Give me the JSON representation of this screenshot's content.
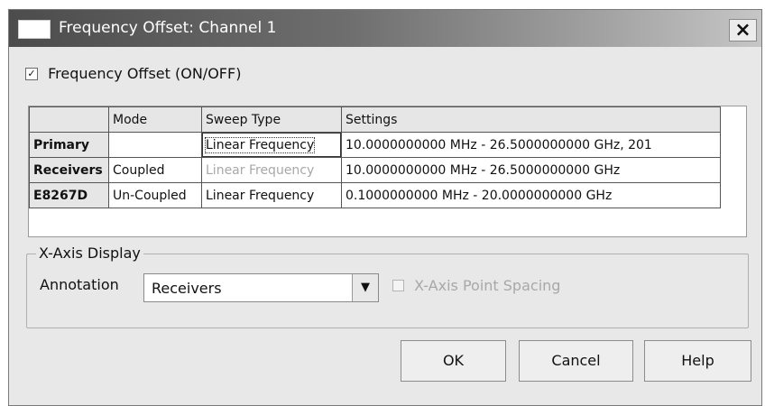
{
  "window": {
    "title": "Frequency Offset: Channel 1",
    "close_symbol": "×"
  },
  "frequency_offset": {
    "label": "Frequency Offset (ON/OFF)",
    "checked": true,
    "check_symbol": "✓"
  },
  "grid": {
    "columns": [
      "",
      "Mode",
      "Sweep Type",
      "Settings"
    ],
    "rows": [
      {
        "name": "Primary",
        "mode": "",
        "sweep_type": "Linear Frequency",
        "sweep_disabled": false,
        "sweep_focused": true,
        "settings": "10.0000000000 MHz - 26.5000000000 GHz, 201"
      },
      {
        "name": "Receivers",
        "mode": "Coupled",
        "sweep_type": "Linear Frequency",
        "sweep_disabled": true,
        "sweep_focused": false,
        "settings": "10.0000000000 MHz - 26.5000000000 GHz"
      },
      {
        "name": "E8267D",
        "mode": "Un-Coupled",
        "sweep_type": "Linear Frequency",
        "sweep_disabled": false,
        "sweep_focused": false,
        "settings": "0.1000000000 MHz - 20.0000000000 GHz"
      }
    ]
  },
  "x_axis_display": {
    "group_label": "X-Axis Display",
    "annotation_label": "Annotation",
    "annotation_value": "Receivers",
    "dropdown_icon": "▼",
    "point_spacing_label": "X-Axis Point Spacing",
    "point_spacing_checked": false,
    "point_spacing_enabled": false
  },
  "buttons": {
    "ok": "OK",
    "cancel": "Cancel",
    "help": "Help"
  },
  "icons": {
    "window_icon": "window-icon",
    "close": "close-icon",
    "dropdown": "chevron-down-icon"
  }
}
